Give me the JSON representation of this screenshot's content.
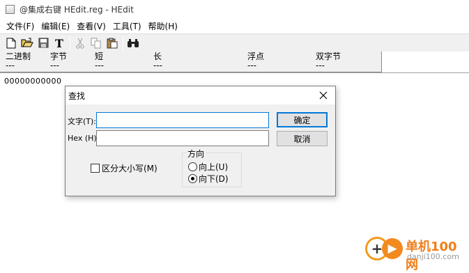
{
  "window": {
    "title": "@集成右键 HEdit.reg - HEdit"
  },
  "menubar": {
    "items": [
      "文件(F)",
      "编辑(E)",
      "查看(V)",
      "工具(T)",
      "帮助(H)"
    ]
  },
  "toolbar": {
    "buttons": [
      "new-file-icon",
      "open-folder-icon",
      "save-icon",
      "font-icon",
      "cut-icon",
      "copy-icon",
      "paste-icon",
      "find-binoculars-icon"
    ]
  },
  "columns": [
    {
      "label": "二进制",
      "value": "---"
    },
    {
      "label": "字节",
      "value": "---"
    },
    {
      "label": "短",
      "value": "---"
    },
    {
      "label": "长",
      "value": "---"
    },
    {
      "label": "浮点",
      "value": "---"
    },
    {
      "label": "双字节",
      "value": "---"
    }
  ],
  "content": {
    "hex_line": "00000000000"
  },
  "find_dialog": {
    "title": "查找",
    "text_label": "文字(T):",
    "text_value": "",
    "hex_label": "Hex (H):",
    "hex_value": "",
    "ok_label": "确定",
    "cancel_label": "取消",
    "case_label": "区分大小写(M)",
    "case_checked": false,
    "direction_title": "方向",
    "up_label": "向上(U)",
    "down_label": "向下(D)",
    "direction_selected": "down"
  },
  "watermark": {
    "brand": "单机100网",
    "url": "danji100.com"
  },
  "colors": {
    "focus_border": "#0078d7",
    "watermark_orange": "#f07f1a"
  }
}
